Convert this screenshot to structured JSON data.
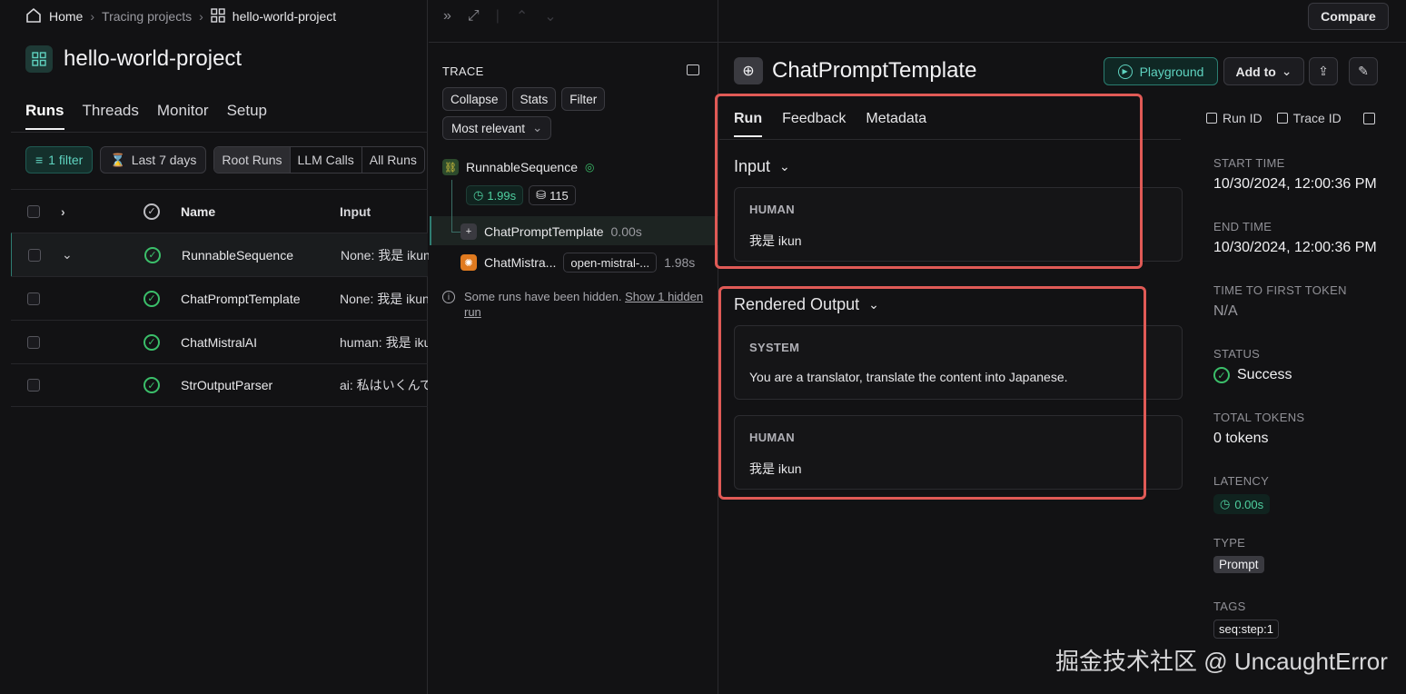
{
  "breadcrumb": {
    "home": "Home",
    "projects": "Tracing projects",
    "current": "hello-world-project"
  },
  "project": {
    "title": "hello-world-project"
  },
  "tabs": [
    "Runs",
    "Threads",
    "Monitor",
    "Setup"
  ],
  "filters": {
    "filter_count": "1 filter",
    "range": "Last 7 days",
    "segments": [
      "Root Runs",
      "LLM Calls",
      "All Runs"
    ]
  },
  "table": {
    "headers": {
      "name": "Name",
      "input": "Input"
    },
    "rows": [
      {
        "name": "RunnableSequence",
        "input": "None: 我是 ikun"
      },
      {
        "name": "ChatPromptTemplate",
        "input": "None: 我是 ikun"
      },
      {
        "name": "ChatMistralAI",
        "input": "human: 我是 ikun"
      },
      {
        "name": "StrOutputParser",
        "input": "ai: 私はいくんです"
      }
    ]
  },
  "trace": {
    "label": "TRACE",
    "buttons": [
      "Collapse",
      "Stats",
      "Filter"
    ],
    "sort": "Most relevant",
    "root": {
      "name": "RunnableSequence",
      "latency": "1.99s",
      "tokens": "115"
    },
    "children": [
      {
        "name": "ChatPromptTemplate",
        "latency": "0.00s"
      },
      {
        "name": "ChatMistra...",
        "model": "open-mistral-...",
        "latency": "1.98s"
      }
    ],
    "hidden_note": "Some runs have been hidden.",
    "hidden_link": "Show 1 hidden run"
  },
  "header": {
    "compare": "Compare"
  },
  "run": {
    "title": "ChatPromptTemplate",
    "playground": "Playground",
    "add_to": "Add to",
    "tabs": [
      "Run",
      "Feedback",
      "Metadata"
    ],
    "run_id": "Run ID",
    "trace_id": "Trace ID",
    "input_label": "Input",
    "input_msgs": [
      {
        "role": "HUMAN",
        "text": "我是 ikun"
      }
    ],
    "output_label": "Rendered Output",
    "output_msgs": [
      {
        "role": "SYSTEM",
        "text": "You are a translator, translate the content into Japanese."
      },
      {
        "role": "HUMAN",
        "text": "我是 ikun"
      }
    ]
  },
  "meta": {
    "start_time_k": "START TIME",
    "start_time_v": "10/30/2024, 12:00:36 PM",
    "end_time_k": "END TIME",
    "end_time_v": "10/30/2024, 12:00:36 PM",
    "ttft_k": "TIME TO FIRST TOKEN",
    "ttft_v": "N/A",
    "status_k": "STATUS",
    "status_v": "Success",
    "tokens_k": "TOTAL TOKENS",
    "tokens_v": "0 tokens",
    "latency_k": "LATENCY",
    "latency_v": "0.00s",
    "type_k": "TYPE",
    "type_v": "Prompt",
    "tags_k": "TAGS",
    "tags_v": "seq:step:1"
  },
  "colors": {
    "accent": "#5fd3c0",
    "success": "#3bbf6a",
    "highlight": "#e05a56"
  },
  "watermark": "掘金技术社区 @ UncaughtError"
}
